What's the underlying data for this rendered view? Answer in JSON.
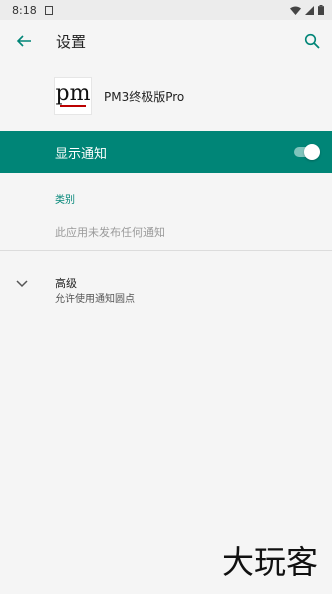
{
  "status_bar": {
    "time": "8:18",
    "notification_icon": "notification-icon",
    "wifi_icon": "wifi-icon",
    "signal_icon": "signal-icon",
    "battery_icon": "battery-icon"
  },
  "toolbar": {
    "title": "设置",
    "back_icon": "arrow-back-icon",
    "search_icon": "search-icon"
  },
  "app": {
    "name": "PM3终极版Pro",
    "icon_label": "pm",
    "accent": "#008577"
  },
  "master_switch": {
    "label": "显示通知",
    "checked": true
  },
  "category": {
    "header": "类别",
    "empty_text": "此应用未发布任何通知"
  },
  "advanced": {
    "title": "高级",
    "summary": "允许使用通知圆点",
    "icon": "chevron-down-icon"
  },
  "watermark": {
    "text": "大玩客"
  }
}
